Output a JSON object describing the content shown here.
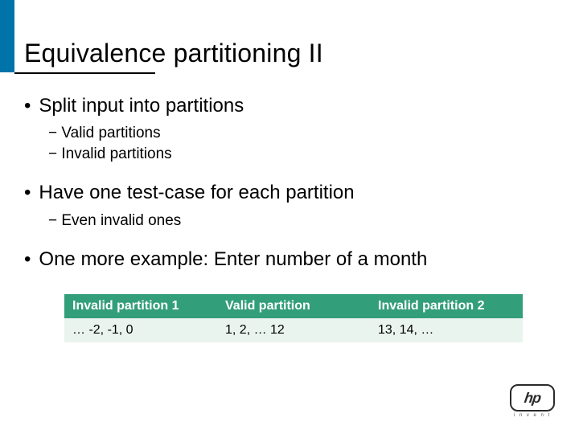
{
  "title": "Equivalence partitioning II",
  "bullets": {
    "b1": {
      "dot": "•",
      "text": "Split input into partitions"
    },
    "b1_sub": [
      "− Valid partitions",
      "− Invalid partitions"
    ],
    "b2": {
      "dot": "•",
      "text": "Have one test-case for each partition"
    },
    "b2_sub": [
      "− Even invalid ones"
    ],
    "b3": {
      "dot": "•",
      "text": "One more example: Enter number of a month"
    }
  },
  "table": {
    "headers": [
      "Invalid partition 1",
      "Valid partition",
      "Invalid partition 2"
    ],
    "row": [
      "… -2, -1, 0",
      "1, 2, … 12",
      "13, 14, …"
    ]
  },
  "logo": {
    "text": "hp",
    "tagline": "i n v e n t"
  }
}
